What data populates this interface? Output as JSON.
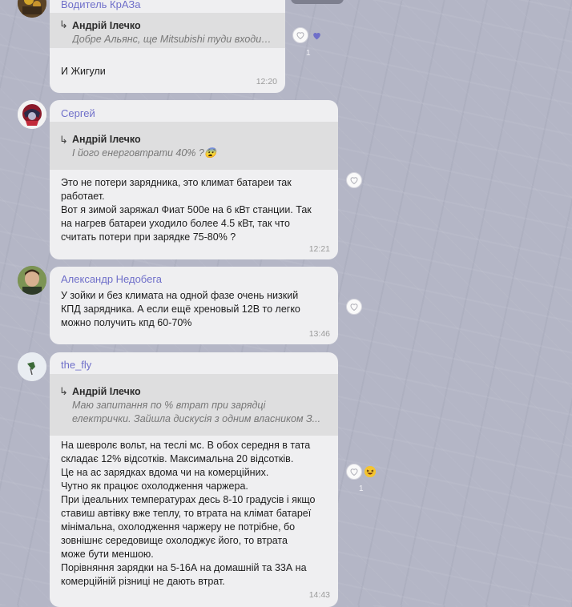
{
  "messages": [
    {
      "sender": "Водитель КрАЗа",
      "reply_author": "Андрій Ілечко",
      "reply_text": "Добре Альянс, ще Mitsubishi туди входить",
      "text": "И Жигули",
      "time": "12:20",
      "reaction": {
        "icon": "purple-heart-icon",
        "count": "1"
      }
    },
    {
      "sender": "Сергей",
      "reply_author": "Андрій Ілечко",
      "reply_text": "І його енерговтрати 40% ?😨",
      "text": "Это не потери зарядника, это климат батареи так\nработает.\nВот я зимой заряжал Фиат 500е на 6 кВт станции. Так\nна нагрев батареи уходило более 4.5 кВт, так что\nсчитать потери при зарядке 75-80% ?",
      "time": "12:21"
    },
    {
      "sender": "Александр Недобега",
      "text": "У зойки и без климата на одной фазе очень низкий\nКПД зарядника. А если ещё хреновый 12В то легко\nможно получить кпд 60-70%",
      "time": "13:46"
    },
    {
      "sender": "the_fly",
      "reply_author": "Андрій Ілечко",
      "reply_text": "Маю запитання по % втрат при зарядці електрички. Зайшла дискусія з одним власником З...",
      "text": "На шевролє вольт, на теслі мс. В обох середня в тата\nскладає 12% відсотків. Максимальна 20 відсотків.\nЦе на ас зарядках вдома чи на комерційних.\nЧутно як працює охолодження чаржера.\nПри ідеальних температурах десь 8-10 градусів і якщо\nставиш автівку вже теплу, то втрата на клімат батареї\nмінімальна, охолодження чаржеру не потрібне, бо\nзовнішнє середовище охолоджує його, то втрата\nможе бути меншою.\nПорівняння зарядки на 5-16А на домашній та 33А на\nкомерційній різниці не дають втрат.",
      "time": "14:43",
      "reaction": {
        "icon": "laughing-emoji-icon",
        "count": "1"
      }
    }
  ],
  "colors": {
    "sender_name": "#6f6fc9",
    "bubble_bg": "#efeff1",
    "reply_bg": "#dededf",
    "heart_reaction": "#6f6fc9"
  }
}
